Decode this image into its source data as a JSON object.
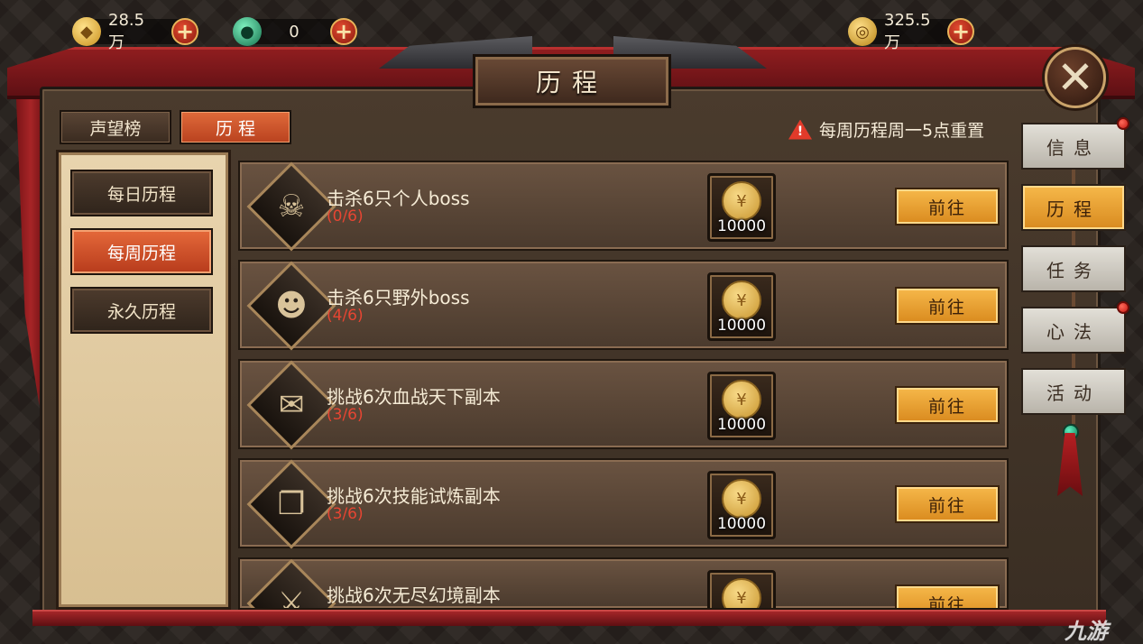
{
  "currencies": [
    {
      "icon": "gold-ingot-icon",
      "value": "28.5万"
    },
    {
      "icon": "jade-icon",
      "value": "0"
    },
    {
      "icon": "coin-icon",
      "value": "325.5万"
    }
  ],
  "header": {
    "title": "历程"
  },
  "top_tabs": [
    {
      "label": "声望榜",
      "active": false
    },
    {
      "label": "历 程",
      "active": true
    }
  ],
  "notice": {
    "text": "每周历程周一5点重置",
    "icon": "warning-icon"
  },
  "sub_tabs": [
    {
      "label": "每日历程",
      "active": false
    },
    {
      "label": "每周历程",
      "active": true
    },
    {
      "label": "永久历程",
      "active": false
    }
  ],
  "tasks": [
    {
      "title": "击杀6只个人boss",
      "progress": "(0/6)",
      "icon": "demon-mask-icon",
      "reward": "10000",
      "button": "前往"
    },
    {
      "title": "击杀6只野外boss",
      "progress": "(4/6)",
      "icon": "skull-helmet-icon",
      "reward": "10000",
      "button": "前往"
    },
    {
      "title": "挑战6次血战天下副本",
      "progress": "(3/6)",
      "icon": "battle-scroll-icon",
      "reward": "10000",
      "button": "前往"
    },
    {
      "title": "挑战6次技能试炼副本",
      "progress": "(3/6)",
      "icon": "open-book-icon",
      "reward": "10000",
      "button": "前往"
    },
    {
      "title": "挑战6次无尽幻境副本",
      "progress": "",
      "icon": "sword-emblem-icon",
      "reward": "",
      "button": "前往"
    }
  ],
  "side_nav": [
    {
      "label": "信息",
      "active": false,
      "badge": true
    },
    {
      "label": "历程",
      "active": true,
      "badge": false
    },
    {
      "label": "任务",
      "active": false,
      "badge": false
    },
    {
      "label": "心法",
      "active": false,
      "badge": true
    },
    {
      "label": "活动",
      "active": false,
      "badge": false
    }
  ],
  "watermark": "九游",
  "colors": {
    "accent_orange": "#e06a3a",
    "button_gold": "#f6b84a",
    "progress_red": "#e64532",
    "banner_red": "#8f1d1f"
  }
}
